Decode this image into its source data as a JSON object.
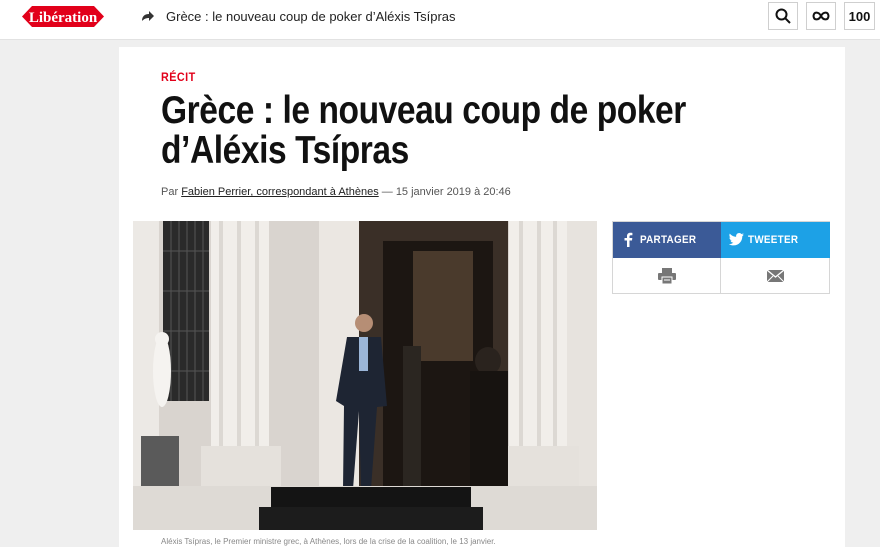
{
  "header": {
    "logo_text": "Libération",
    "article_title": "Grèce : le nouveau coup de poker d’Aléxis Tsípras",
    "subscribe_label": "100"
  },
  "article": {
    "kicker": "RÉCIT",
    "headline": "Grèce : le nouveau coup de poker d’Aléxis Tsípras",
    "byline_prefix": "Par ",
    "author": "Fabien Perrier, correspondant à Athènes",
    "date": " — 15 janvier 2019 à 20:46",
    "caption": "Aléxis Tsípras, le Premier ministre grec, à Athènes, lors de la crise de la coalition, le 13 janvier."
  },
  "share": {
    "facebook_label": "PARTAGER",
    "twitter_label": "TWEETER"
  },
  "colors": {
    "brand_red": "#e2001a",
    "facebook": "#3b5a97",
    "twitter": "#1da1e6"
  },
  "icons": [
    "share-arrow-icon",
    "search-icon",
    "infinity-icon",
    "facebook-icon",
    "twitter-icon",
    "print-icon",
    "mail-icon"
  ]
}
